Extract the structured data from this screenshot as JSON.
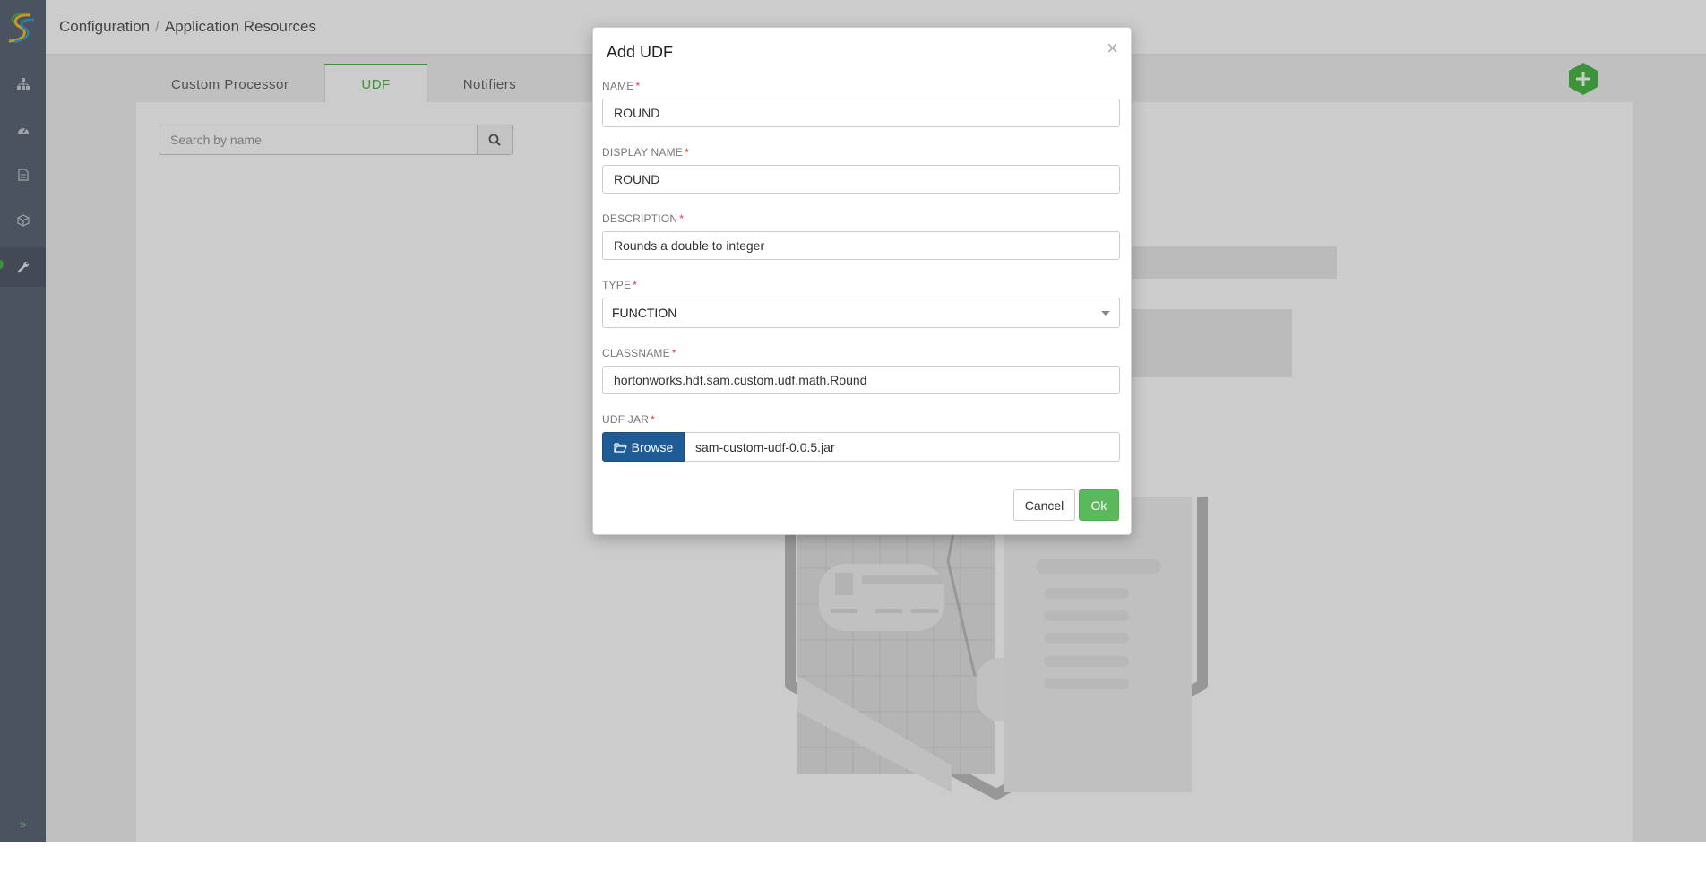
{
  "breadcrumb": {
    "parent": "Configuration",
    "separator": "/",
    "current": "Application Resources"
  },
  "tabs": [
    {
      "label": "Custom Processor"
    },
    {
      "label": "UDF"
    },
    {
      "label": "Notifiers"
    }
  ],
  "search": {
    "placeholder": "Search by name"
  },
  "sidebar": {
    "icons": [
      "topology-icon",
      "dashboard-icon",
      "document-icon",
      "cube-icon",
      "wrench-icon"
    ],
    "active": "wrench-icon",
    "expand_glyph": "»"
  },
  "modal": {
    "title": "Add UDF",
    "close_glyph": "×",
    "required_mark": "*",
    "fields": {
      "name": {
        "label": "NAME",
        "value": "ROUND"
      },
      "display_name": {
        "label": "DISPLAY NAME",
        "value": "ROUND"
      },
      "description": {
        "label": "DESCRIPTION",
        "value": "Rounds a double to integer"
      },
      "type": {
        "label": "TYPE",
        "value": "FUNCTION"
      },
      "classname": {
        "label": "CLASSNAME",
        "value": "hortonworks.hdf.sam.custom.udf.math.Round"
      },
      "udf_jar": {
        "label": "UDF JAR",
        "browse_label": "Browse",
        "value": "sam-custom-udf-0.0.5.jar"
      }
    },
    "cancel_label": "Cancel",
    "ok_label": "Ok"
  },
  "colors": {
    "sidebar": "#606878",
    "accent_green": "#4cb848",
    "browse_blue": "#1f5b94",
    "required_red": "#e53935",
    "ok_green": "#5cb85c"
  }
}
